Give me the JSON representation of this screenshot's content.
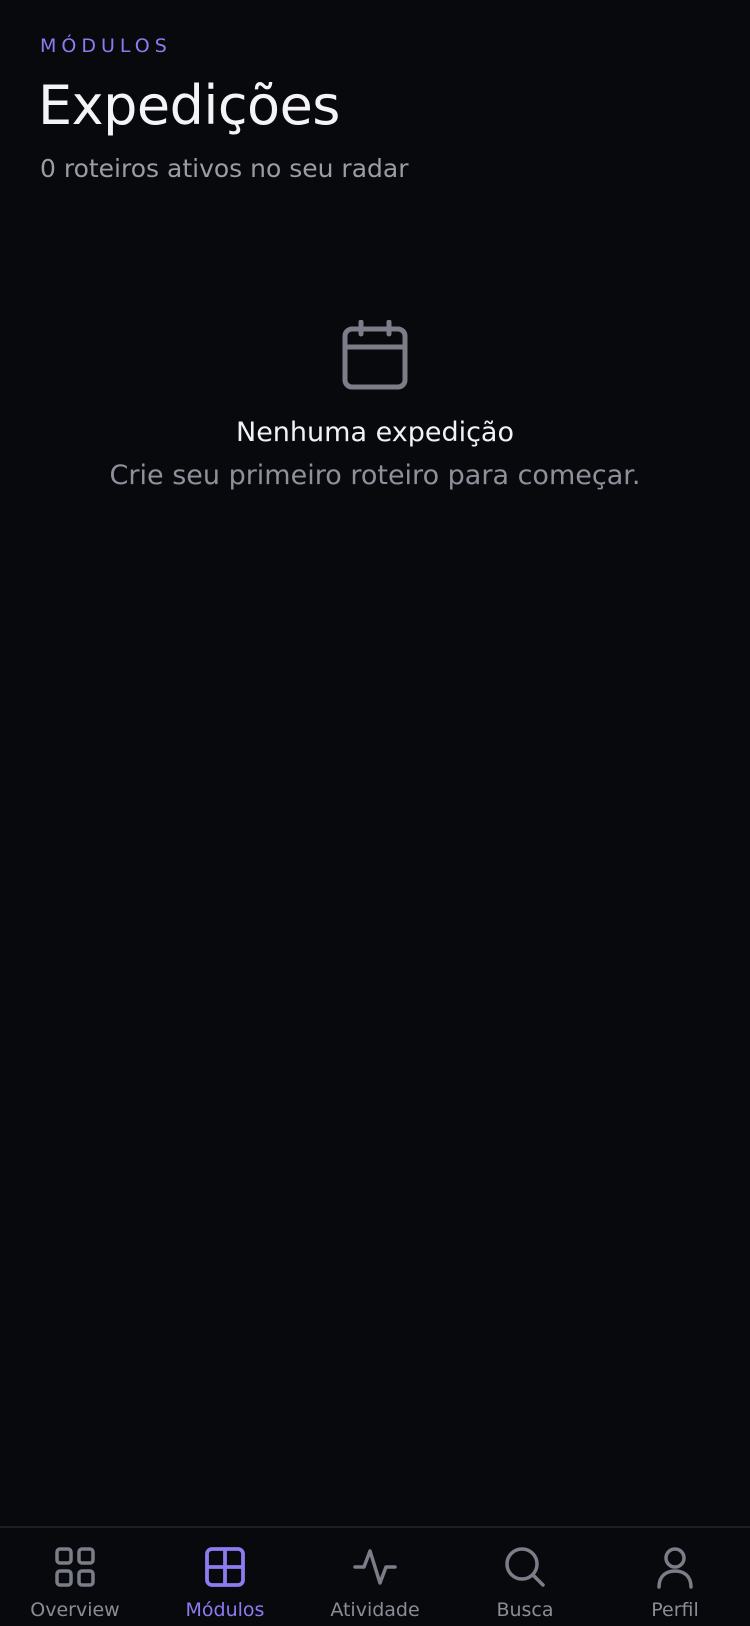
{
  "header": {
    "eyebrow": "MÓDULOS",
    "title": "Expedições",
    "subtitle": "0 roteiros ativos no seu radar"
  },
  "empty_state": {
    "icon": "calendar-icon",
    "title": "Nenhuma expedição",
    "description": "Crie seu primeiro roteiro para começar."
  },
  "tabbar": {
    "active": "Módulos",
    "items": [
      {
        "label": "Overview",
        "icon": "grid-icon"
      },
      {
        "label": "Módulos",
        "icon": "modules-icon"
      },
      {
        "label": "Atividade",
        "icon": "activity-icon"
      },
      {
        "label": "Busca",
        "icon": "search-icon"
      },
      {
        "label": "Perfil",
        "icon": "user-icon"
      }
    ]
  },
  "colors": {
    "background": "#08090d",
    "accent": "#8b7cf0",
    "muted": "#8a8c96",
    "icon": "#7b7d88"
  }
}
